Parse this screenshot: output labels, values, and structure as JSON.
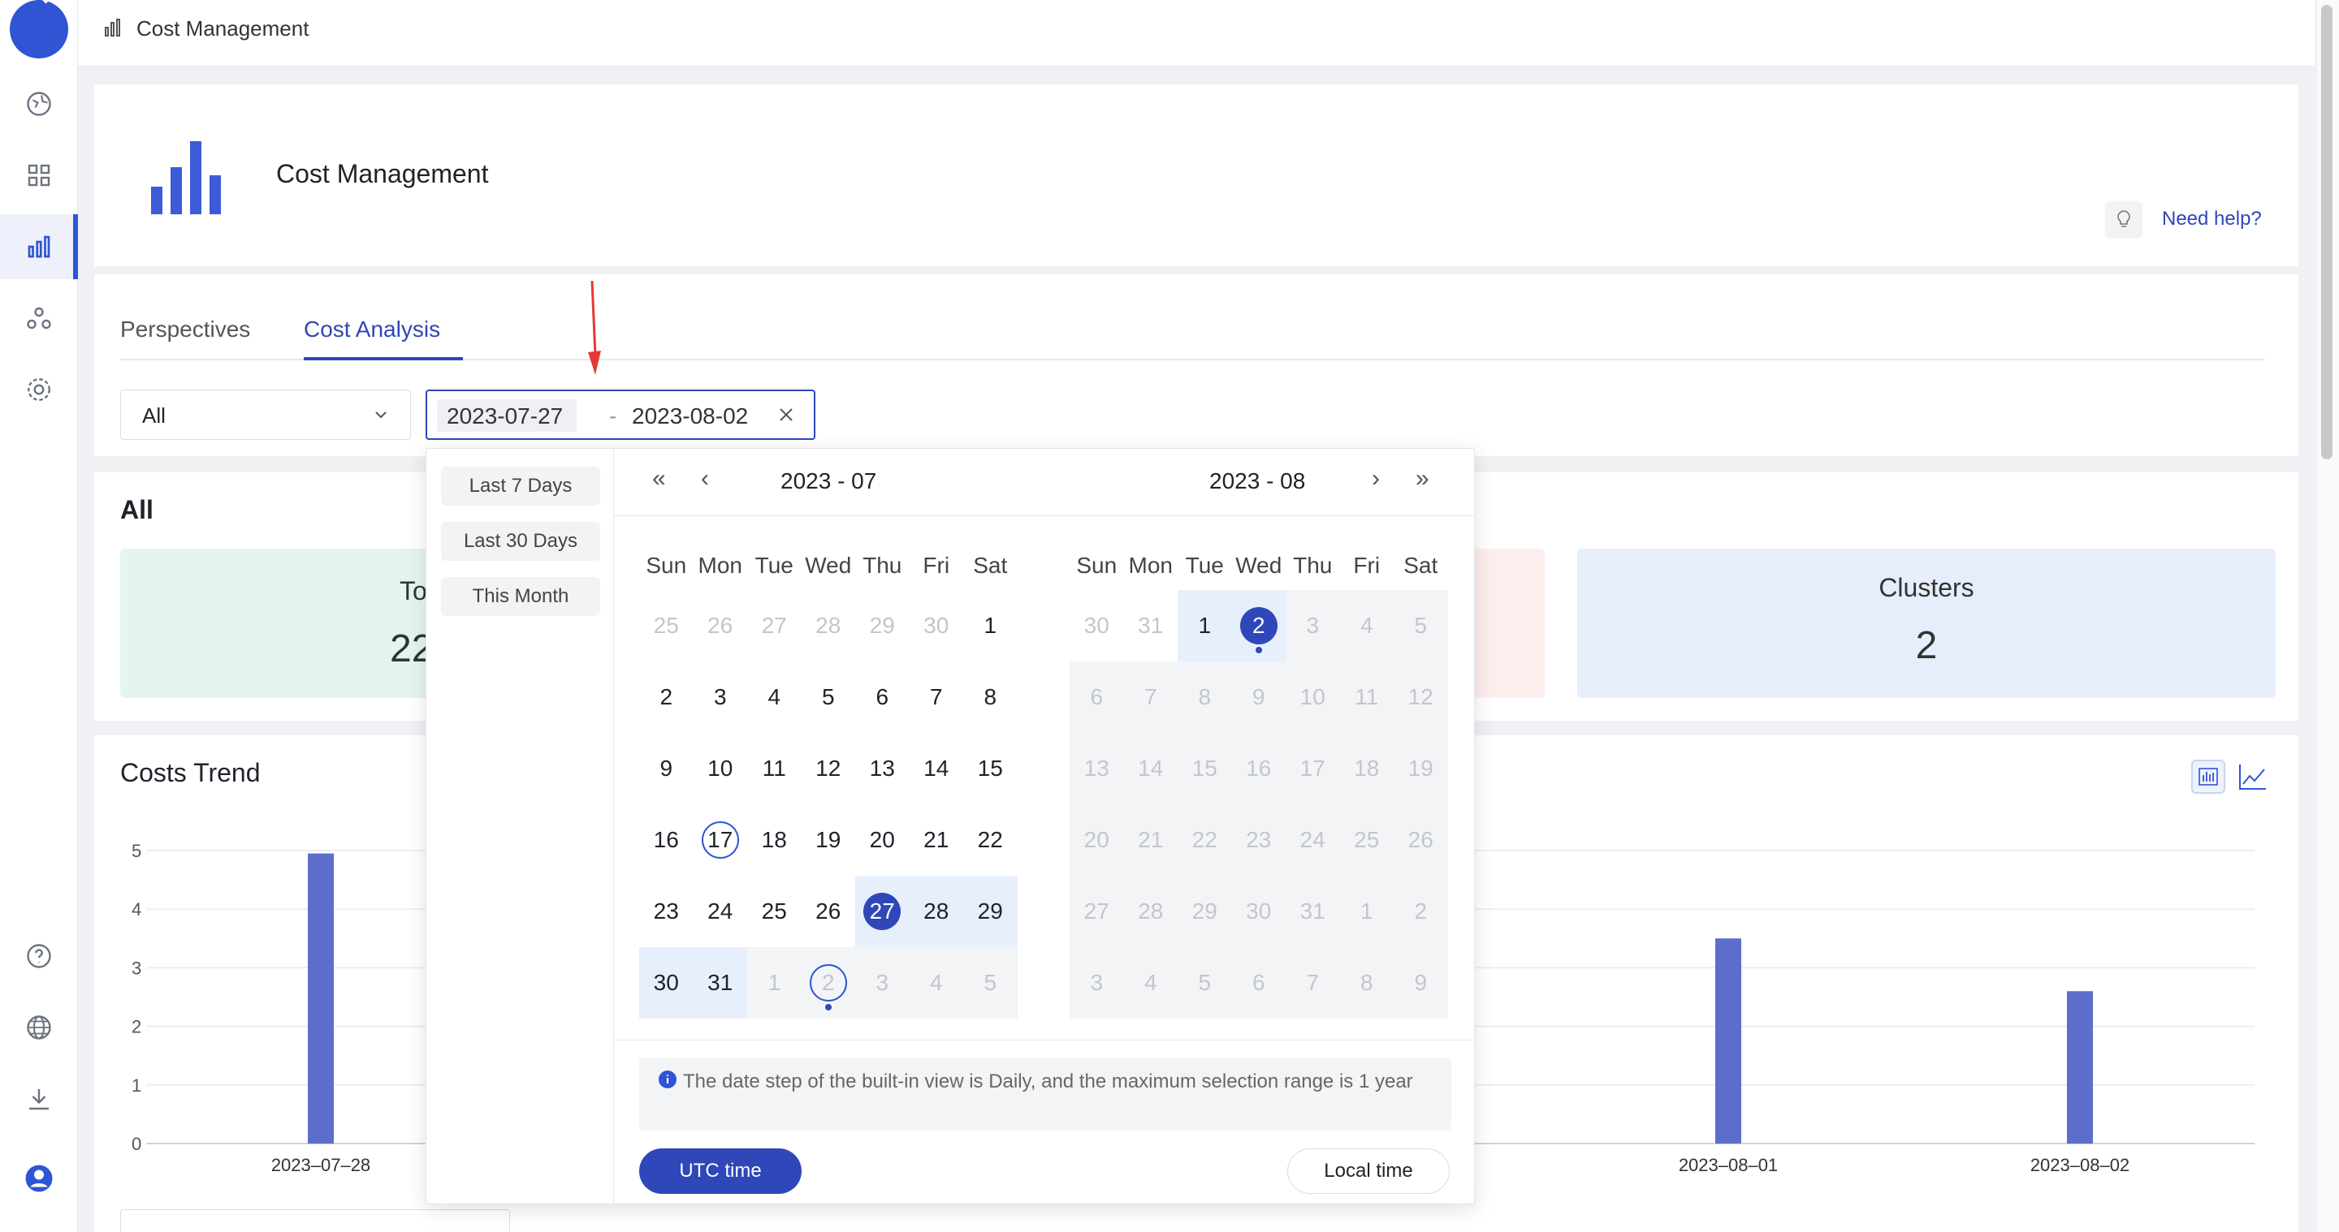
{
  "header": {
    "title": "Cost Management"
  },
  "page": {
    "title": "Cost Management",
    "help": "Need help?"
  },
  "tabs": [
    {
      "label": "Perspectives"
    },
    {
      "label": "Cost Analysis"
    }
  ],
  "filter": {
    "scope": "All",
    "start": "2023-07-27",
    "sep": "-",
    "end": "2023-08-02"
  },
  "summary": {
    "title": "All",
    "cards": [
      {
        "label": "To",
        "value": "22"
      },
      {
        "label": "Clusters",
        "value": "2"
      }
    ]
  },
  "trend": {
    "title": "Costs Trend"
  },
  "chart_data": {
    "type": "bar",
    "y_ticks": [
      "5",
      "4",
      "3",
      "2",
      "1",
      "0"
    ],
    "ylim": [
      0,
      5
    ],
    "categories": [
      "2023–07–28",
      "2023–08–01",
      "2023–08–02"
    ],
    "values": [
      4.95,
      3.5,
      2.6
    ],
    "color": "#5b6ecc"
  },
  "calendar": {
    "presets": [
      "Last 7 Days",
      "Last 30 Days",
      "This Month"
    ],
    "weekdays": [
      "Sun",
      "Mon",
      "Tue",
      "Wed",
      "Thu",
      "Fri",
      "Sat"
    ],
    "left": {
      "title": "2023 - 07"
    },
    "right": {
      "title": "2023 - 08"
    },
    "notice": "The date step of the built-in view is Daily, and the maximum selection range is 1 year",
    "utc": "UTC time",
    "local": "Local time"
  },
  "colors": {
    "accent": "#2f47b8",
    "bar": "#5b6ecc"
  }
}
